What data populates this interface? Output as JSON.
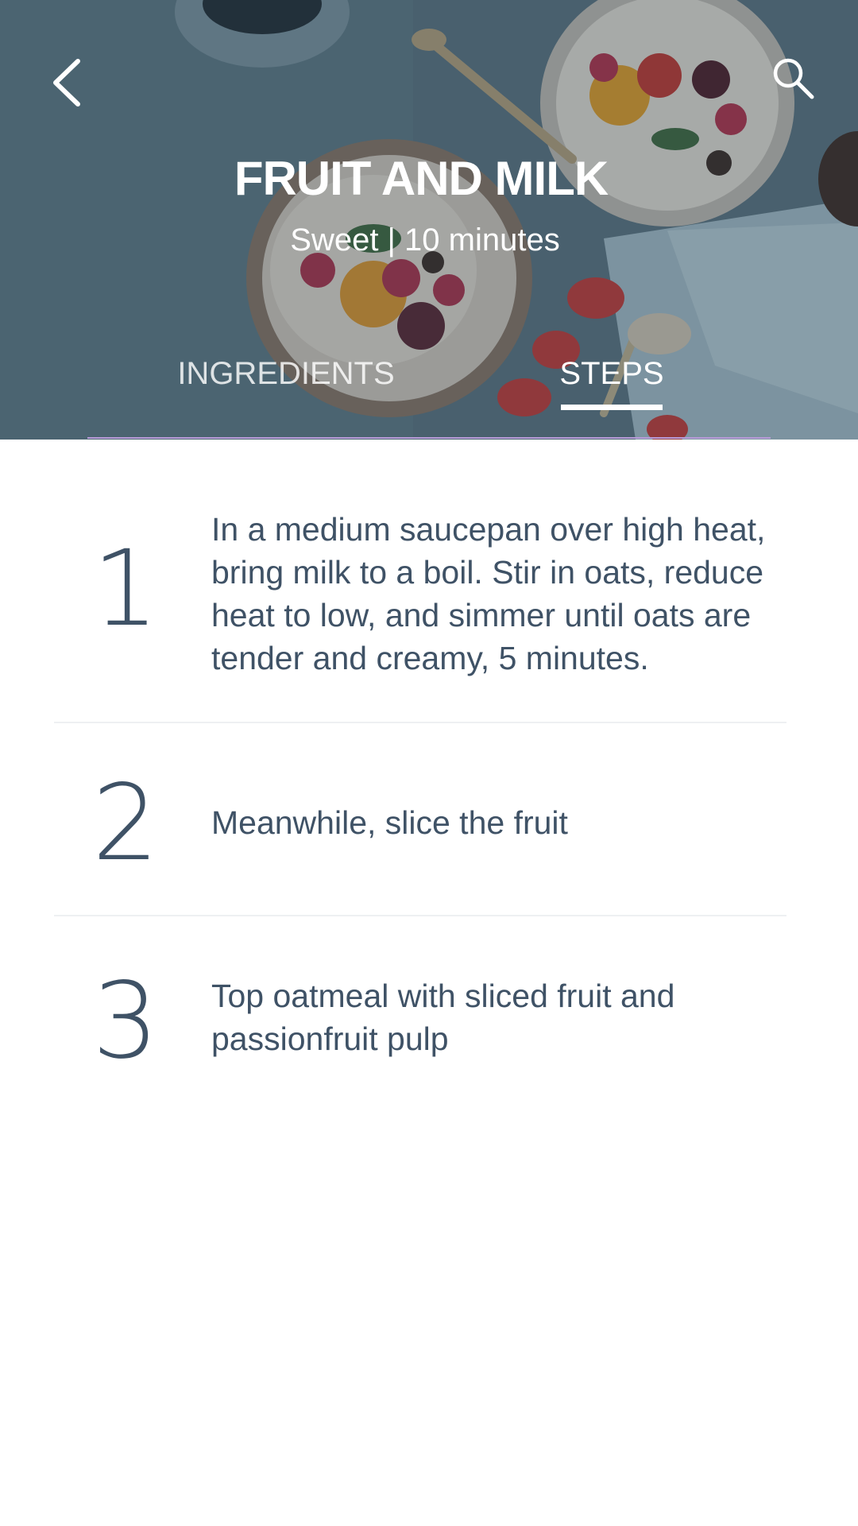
{
  "header": {
    "title": "FRUIT AND MILK",
    "subtitle": "Sweet | 10 minutes",
    "back_icon": "chevron-left-icon",
    "search_icon": "search-icon"
  },
  "tabs": [
    {
      "label": "INGREDIENTS",
      "active": false
    },
    {
      "label": "STEPS",
      "active": true
    }
  ],
  "steps": [
    {
      "number": "1",
      "text": "In a medium saucepan over high heat, bring milk to a boil. Stir in oats, reduce heat to low, and simmer until oats are tender and creamy, 5 minutes."
    },
    {
      "number": "2",
      "text": "Meanwhile, slice the fruit"
    },
    {
      "number": "3",
      "text": "Top oatmeal with sliced fruit and passionfruit pulp"
    }
  ],
  "colors": {
    "text_primary": "#3f5266",
    "hero_overlay": "#3f5866",
    "divider": "#eef0f2",
    "tab_indicator": "#ffffff"
  }
}
